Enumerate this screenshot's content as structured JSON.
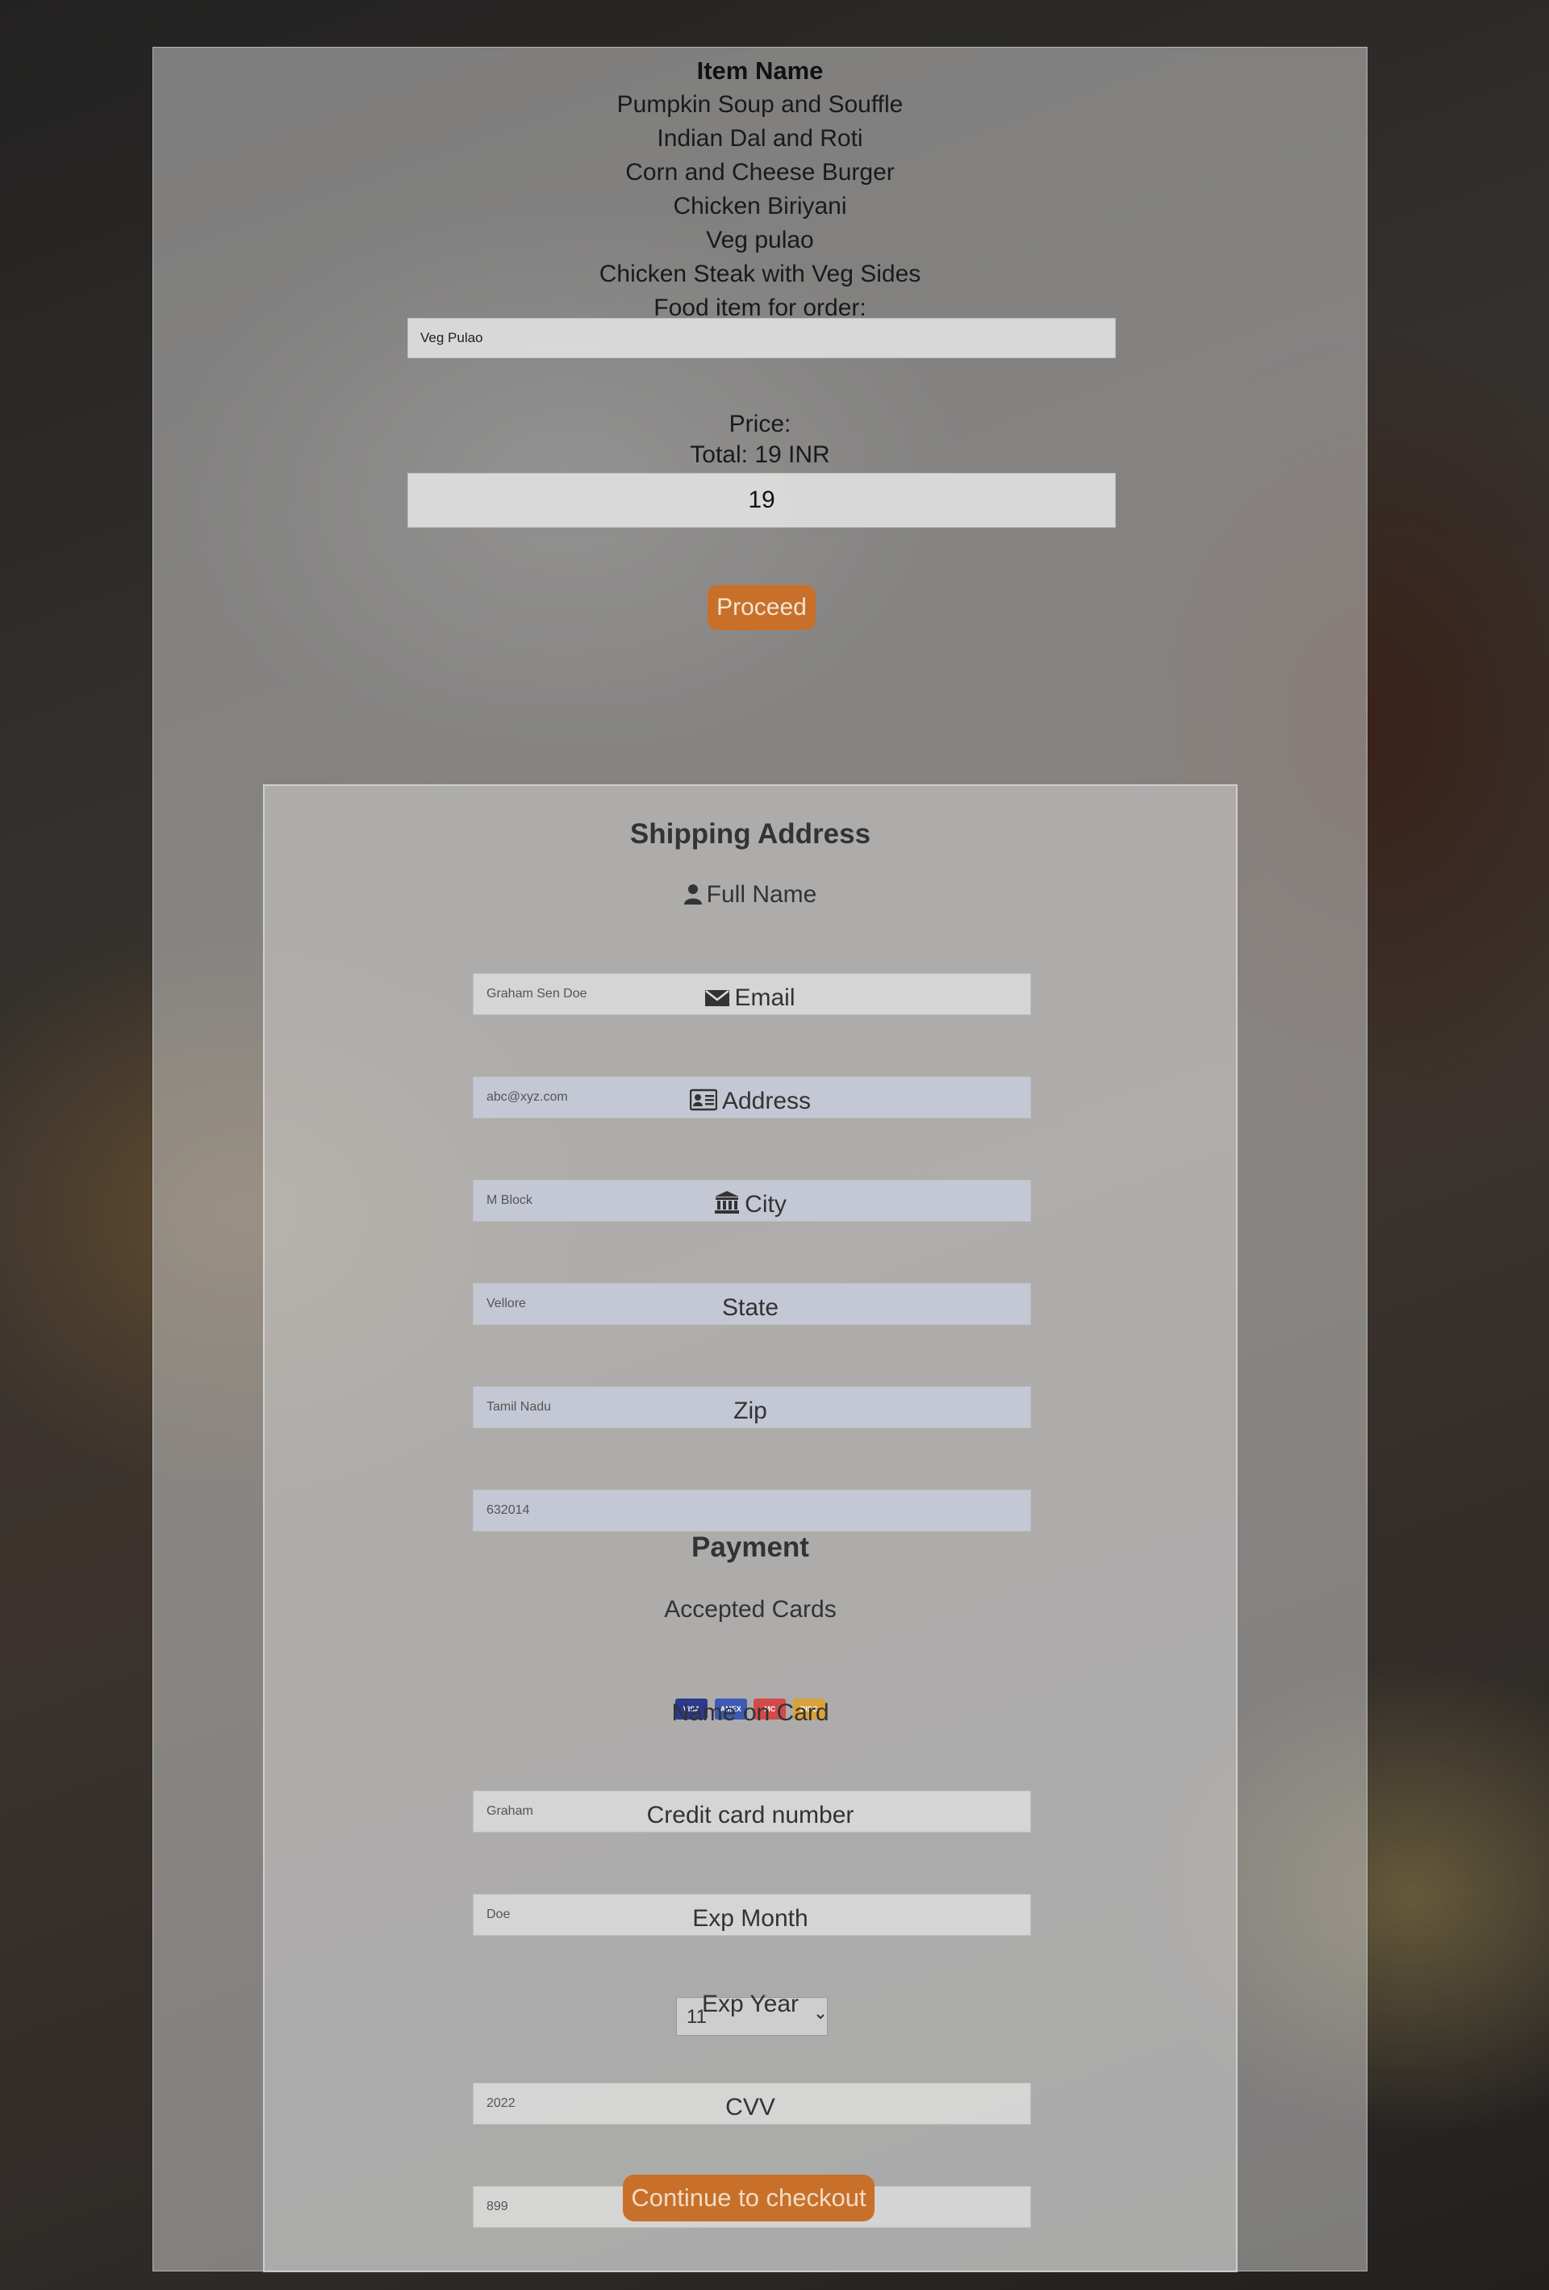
{
  "menu": {
    "header": "Item Name",
    "items": [
      "Pumpkin Soup and Souffle",
      "Indian Dal and Roti",
      "Corn and Cheese Burger",
      "Chicken Biriyani",
      "Veg pulao",
      "Chicken Steak with Veg Sides"
    ],
    "order_label": "Food item for order:",
    "order_value": "Veg Pulao"
  },
  "pricing": {
    "price_label": "Price:",
    "total_label": "Total: 19 INR",
    "price_value": "19",
    "proceed_label": "Proceed"
  },
  "shipping": {
    "title": "Shipping Address",
    "full_name_label": "Full Name",
    "full_name_value": "Graham Sen Doe",
    "email_label": "Email",
    "email_value": "abc@xyz.com",
    "address_label": "Address",
    "address_value": "M Block",
    "city_label": "City",
    "city_value": "Vellore",
    "state_label": "State",
    "state_value": "Tamil Nadu",
    "zip_label": "Zip",
    "zip_value": "632014"
  },
  "payment": {
    "title": "Payment",
    "accepted_cards_label": "Accepted Cards",
    "cards": [
      "VISA",
      "AMEX",
      "MC",
      "DISC"
    ],
    "name_on_card_label": "Name on Card",
    "name_on_card_value": "Graham",
    "card_number_label": "Credit card number",
    "card_number_value": "Doe",
    "exp_month_label": "Exp Month",
    "exp_month_value": "11",
    "exp_year_label": "Exp Year",
    "exp_year_value": "2022",
    "cvv_label": "CVV",
    "cvv_value": "899",
    "checkout_label": "Continue to checkout"
  },
  "colors": {
    "button": "#c8702a",
    "panel": "#c8c8c8"
  }
}
